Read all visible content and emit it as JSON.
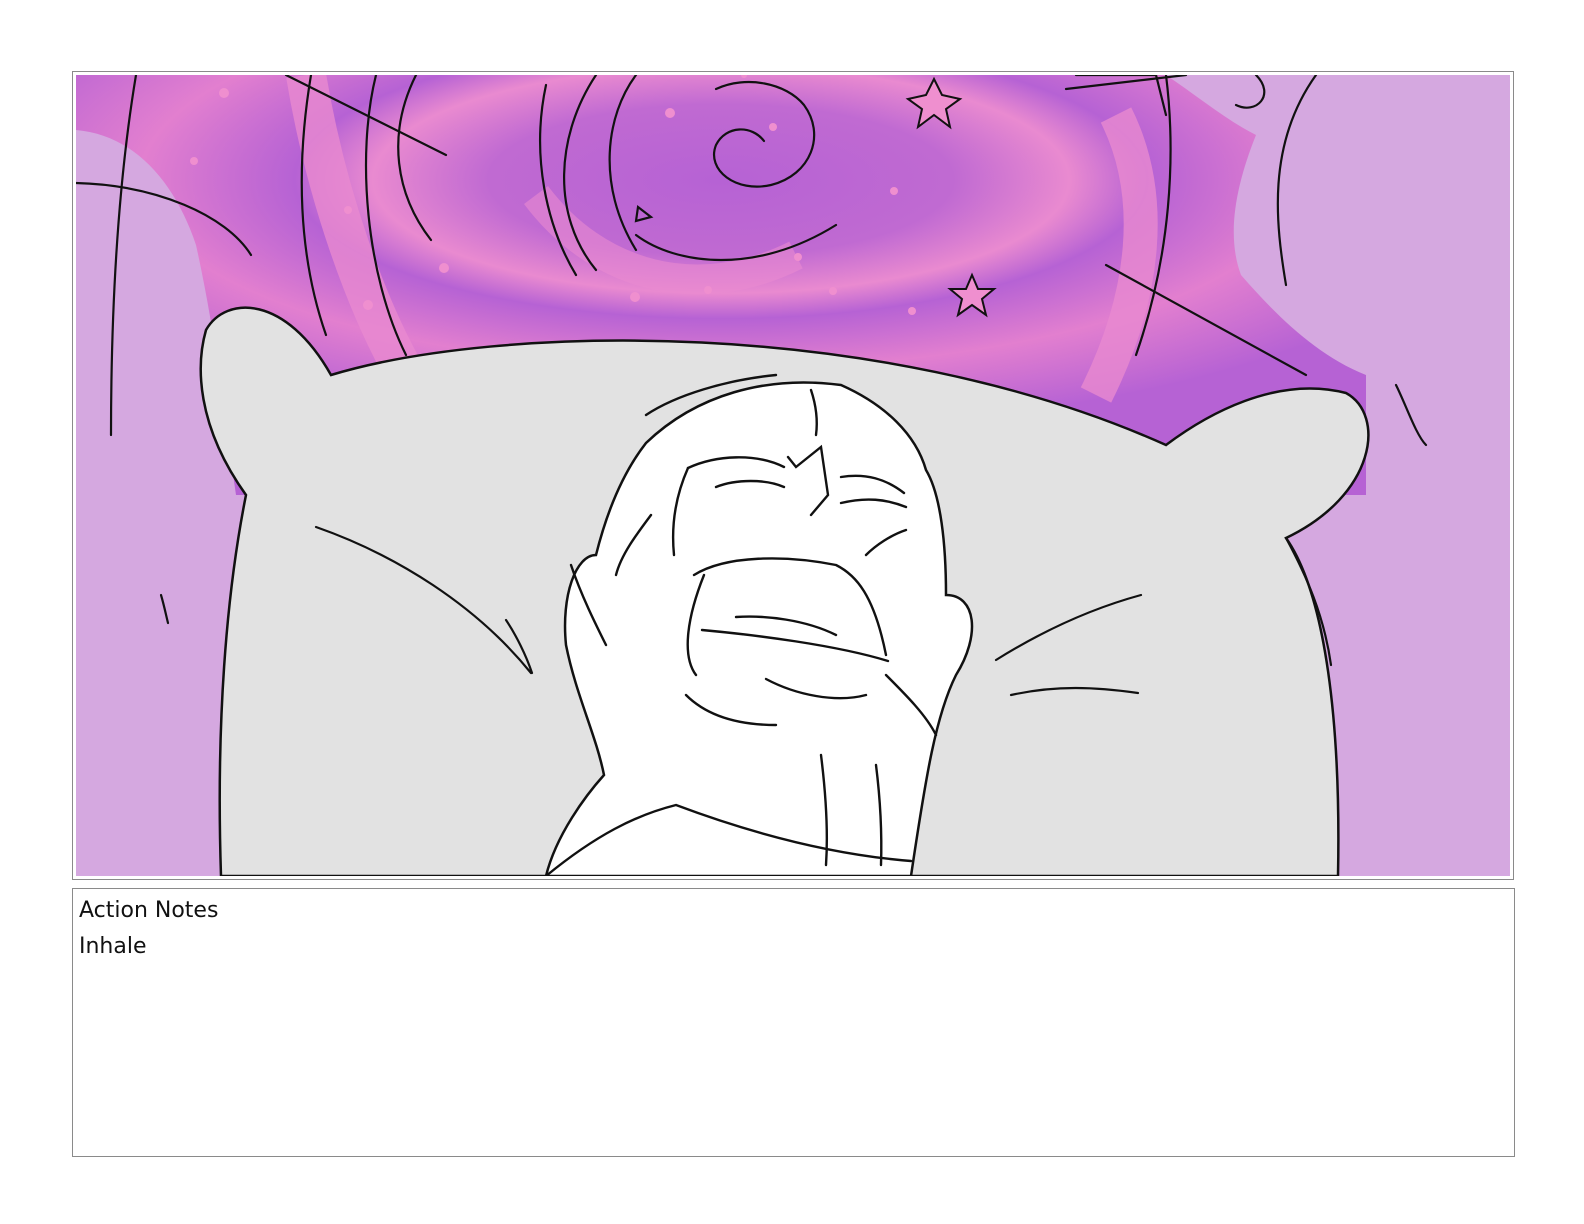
{
  "notes": {
    "heading": "Action Notes",
    "text": "Inhale"
  },
  "panel": {
    "image": "storyboard-sketch-screaming-man-pillow-purple-swirl",
    "colors": {
      "background_light": "#d5a8e0",
      "swirl_purple": "#b662d4",
      "swirl_pink": "#e98ad0",
      "pillow_gray": "#e2e2e2",
      "star_pink": "#ef8fcf",
      "ink": "#111111"
    }
  }
}
